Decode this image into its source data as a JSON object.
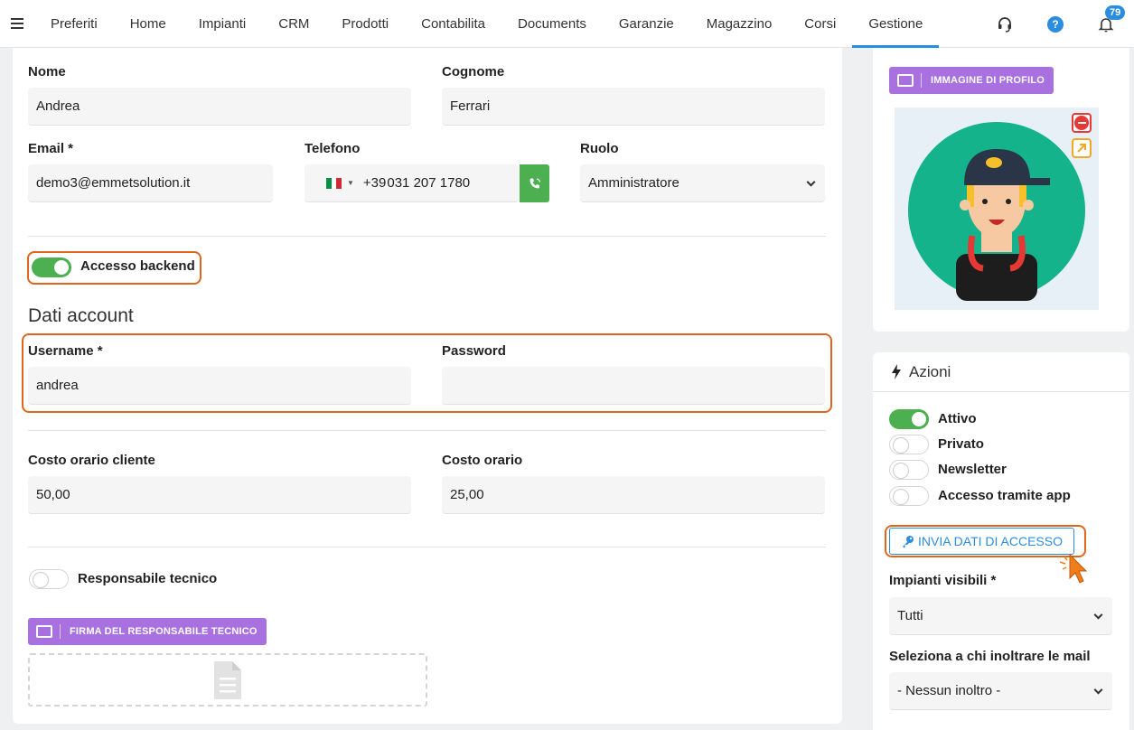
{
  "nav": {
    "items": [
      "Preferiti",
      "Home",
      "Impianti",
      "CRM",
      "Prodotti",
      "Contabilita",
      "Documents",
      "Garanzie",
      "Magazzino",
      "Corsi",
      "Gestione"
    ],
    "active": "Gestione",
    "help_icon": "?",
    "notification_count": "79"
  },
  "form": {
    "nome_label": "Nome",
    "nome_value": "Andrea",
    "cognome_label": "Cognome",
    "cognome_value": "Ferrari",
    "email_label": "Email *",
    "email_value": "demo3@emmetsolution.it",
    "telefono_label": "Telefono",
    "telefono_prefix": "+39",
    "telefono_value": "031 207 1780",
    "ruolo_label": "Ruolo",
    "ruolo_value": "Amministratore",
    "accesso_backend_label": "Accesso backend",
    "dati_account_title": "Dati account",
    "username_label": "Username *",
    "username_value": "andrea",
    "password_label": "Password",
    "password_value": "",
    "costo_cliente_label": "Costo orario cliente",
    "costo_cliente_value": "50,00",
    "costo_orario_label": "Costo orario",
    "costo_orario_value": "25,00",
    "responsabile_label": "Responsabile tecnico",
    "firma_button": "FIRMA DEL RESPONSABILE TECNICO"
  },
  "profile": {
    "image_button": "IMMAGINE DI PROFILO"
  },
  "azioni": {
    "title": "Azioni",
    "toggles": [
      {
        "label": "Attivo",
        "on": true
      },
      {
        "label": "Privato",
        "on": false
      },
      {
        "label": "Newsletter",
        "on": false
      },
      {
        "label": "Accesso tramite app",
        "on": false
      }
    ],
    "send_button": "INVIA DATI DI ACCESSO",
    "impianti_label": "Impianti visibili *",
    "impianti_value": "Tutti",
    "inoltro_label": "Seleziona a chi inoltrare le mail",
    "inoltro_value": "- Nessun inoltro -"
  },
  "colors": {
    "accent": "#2b8de0",
    "highlight": "#e0661b",
    "toggle_on": "#4caf50",
    "purple": "#a970e0"
  }
}
